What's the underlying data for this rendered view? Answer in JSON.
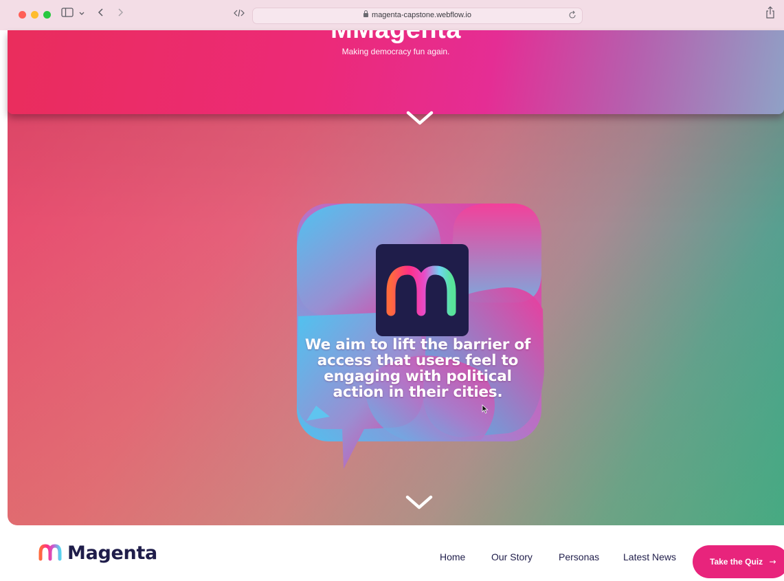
{
  "browser": {
    "url": "magenta-capstone.webflow.io",
    "icons": [
      "sidebar-icon",
      "chevron-down-icon",
      "back-icon",
      "forward-icon",
      "code-icon",
      "lock-icon",
      "reload-icon",
      "share-icon"
    ]
  },
  "hero": {
    "title": "MMagenta",
    "tagline": "Making democracy fun again."
  },
  "mission": {
    "text": "We aim to lift the barrier of access that users feel to engaging with political action in their cities."
  },
  "nav": {
    "brand": "Magenta",
    "links": [
      "Home",
      "Our Story",
      "Personas",
      "Latest News"
    ],
    "cta": "Take the Quiz",
    "cta_arrow": "→"
  },
  "colors": {
    "brand_navy": "#1f1d4a",
    "brand_pink": "#e8247c",
    "hero_gradient": [
      "#ea2d5c",
      "#ec2a78",
      "#e52d94",
      "#8fa1c6"
    ],
    "mission_gradient": [
      "#e8496c",
      "#cf7a8a",
      "#2aa88d"
    ]
  }
}
